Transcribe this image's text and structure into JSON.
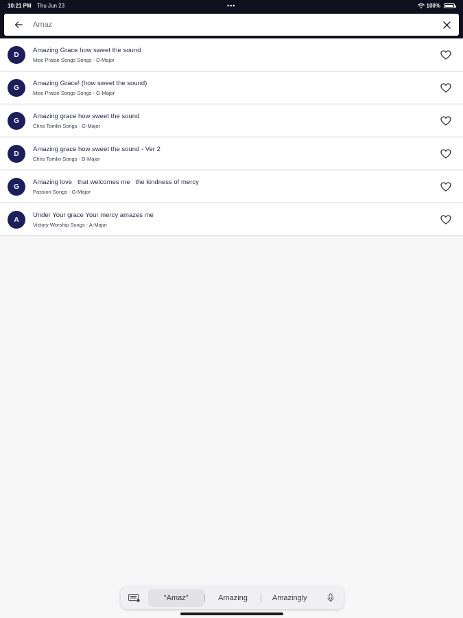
{
  "status_bar": {
    "time": "10:21 PM",
    "date": "Thu Jun 23",
    "dots": "•••",
    "battery": "100%"
  },
  "search": {
    "value": "Amaz",
    "back_icon": "arrow-left-icon",
    "clear_icon": "close-icon"
  },
  "results": [
    {
      "initial": "D",
      "title": "Amazing Grace how sweet the sound",
      "subtitle": "Misc Praise Songs Songs - D-Major"
    },
    {
      "initial": "G",
      "title": "Amazing Grace! (how sweet the sound)",
      "subtitle": "Misc Praise Songs Songs - G-Major"
    },
    {
      "initial": "G",
      "title": "Amazing grace how sweet the sound",
      "subtitle": "Chris Tomlin Songs - G-Major"
    },
    {
      "initial": "D",
      "title": "Amazing grace how sweet the sound - Ver 2",
      "subtitle": "Chris Tomlin Songs - D-Major"
    },
    {
      "initial": "G",
      "title": "Amazing love   that welcomes me   the kindness of mercy",
      "subtitle": "Passion Songs - G-Major"
    },
    {
      "initial": "A",
      "title": "Under Your grace Your mercy amazes me",
      "subtitle": "Victory Worship Songs - A-Major"
    }
  ],
  "keyboard_suggestions": {
    "items": [
      "\"Amaz\"",
      "Amazing",
      "Amazingly"
    ]
  },
  "colors": {
    "header_dark": "#0f0f1e",
    "avatar_navy": "#1b1f5e"
  }
}
